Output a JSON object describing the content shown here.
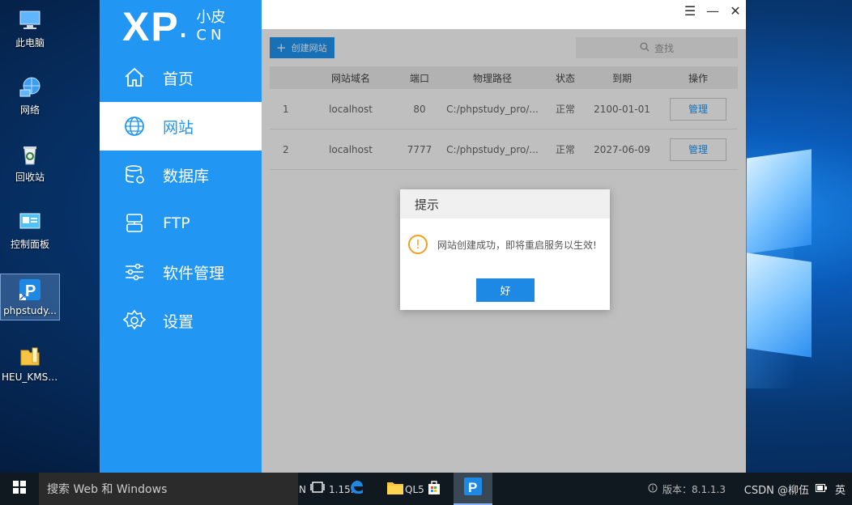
{
  "desktop": {
    "icons": [
      {
        "label": "此电脑",
        "icon": "computer-icon"
      },
      {
        "label": "网络",
        "icon": "network-icon"
      },
      {
        "label": "回收站",
        "icon": "recycle-bin-icon"
      },
      {
        "label": "控制面板",
        "icon": "control-panel-icon"
      },
      {
        "label": "phpstudy...",
        "icon": "phpstudy-icon"
      },
      {
        "label": "HEU_KMS_...",
        "icon": "folder-icon"
      }
    ]
  },
  "app": {
    "logo": {
      "main": "XP",
      "dot": ".",
      "side_top": "小皮",
      "side_bottom": "CN"
    },
    "nav": [
      {
        "label": "首页",
        "icon": "home-icon"
      },
      {
        "label": "网站",
        "icon": "globe-icon"
      },
      {
        "label": "数据库",
        "icon": "database-icon"
      },
      {
        "label": "FTP",
        "icon": "ftp-server-icon"
      },
      {
        "label": "软件管理",
        "icon": "sliders-icon"
      },
      {
        "label": "设置",
        "icon": "gear-icon"
      }
    ],
    "window_buttons": {
      "menu": "☰",
      "minimize": "—",
      "close": "✕"
    },
    "toolbar": {
      "create_label": "创建网站",
      "search_placeholder": "查找"
    },
    "table": {
      "headers": [
        "",
        "网站域名",
        "端口",
        "物理路径",
        "状态",
        "到期",
        "操作"
      ],
      "rows": [
        {
          "num": "1",
          "domain": "localhost",
          "port": "80",
          "path": "C:/phpstudy_pro/...",
          "status": "正常",
          "expire": "2100-01-01",
          "action": "管理"
        },
        {
          "num": "2",
          "domain": "localhost",
          "port": "7777",
          "path": "C:/phpstudy_pro/...",
          "status": "正常",
          "expire": "2027-06-09",
          "action": "管理"
        }
      ]
    },
    "dialog": {
      "title": "提示",
      "message": "网站创建成功，即将重启服务以生效!",
      "ok": "好"
    }
  },
  "taskbar": {
    "search_placeholder": "搜索 Web 和 Windows",
    "fragment_left": "N",
    "fragment_mid": "1.15.",
    "fragment_mid2": "QL5",
    "version": "版本：8.1.1.3",
    "tray_text": "CSDN @柳伍",
    "lang": "英"
  }
}
